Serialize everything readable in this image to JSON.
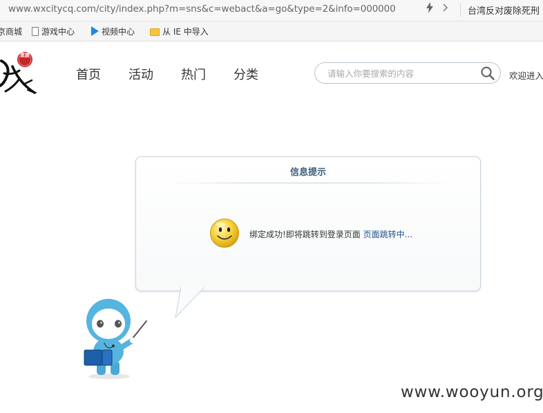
{
  "browser": {
    "url": "www.wxcitycq.com/city/index.php?m=sns&c=webact&a=go&type=2&info=000000",
    "news_text": "台湾反对废除死刑",
    "bookmarks": [
      {
        "label": "京商城",
        "icon": "none"
      },
      {
        "label": "游戏中心",
        "icon": "doc-icon"
      },
      {
        "label": "视频中心",
        "icon": "play-icon"
      },
      {
        "label": "从 IE 中导入",
        "icon": "folder-icon"
      }
    ]
  },
  "site": {
    "logo_seal_text": "重慶",
    "nav": [
      "首页",
      "活动",
      "热门",
      "分类"
    ],
    "search": {
      "placeholder": "请输入你要搜索的内容",
      "value": ""
    },
    "welcome": "欢迎进入"
  },
  "message": {
    "title": "信息提示",
    "text": "绑定成功!即将跳转到登录页面",
    "link": "页面跳转中..."
  },
  "watermark": "www.wooyun.org",
  "colors": {
    "title": "#3e5e7c",
    "link": "#1f4f87",
    "mascot_body": "#55b4e0",
    "smiley": "#f6d23a"
  }
}
